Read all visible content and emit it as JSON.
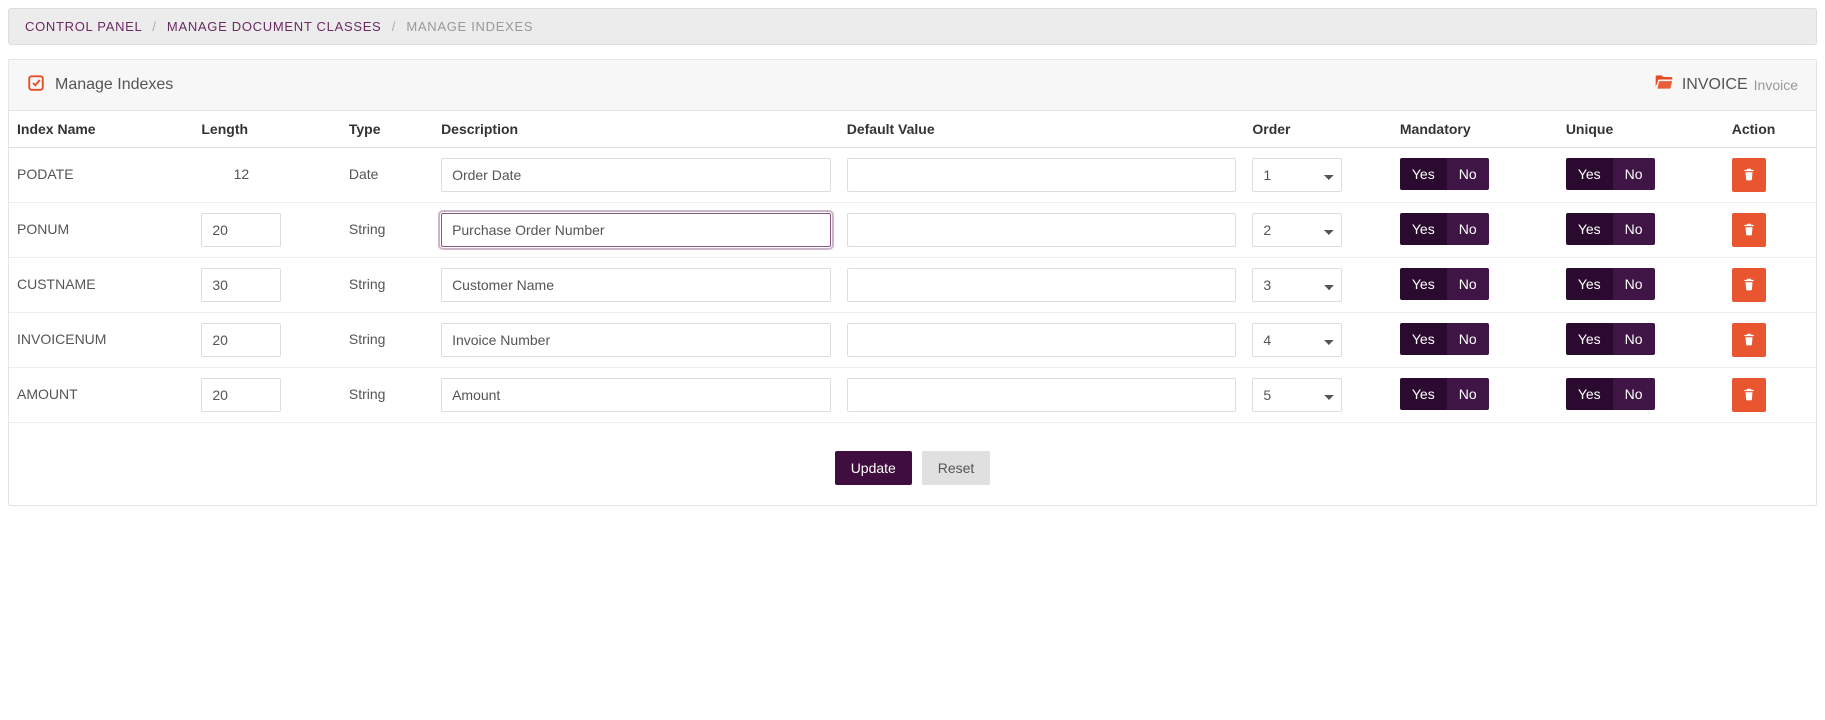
{
  "breadcrumb": {
    "items": [
      "CONTROL PANEL",
      "MANAGE DOCUMENT CLASSES",
      "MANAGE INDEXES"
    ]
  },
  "panel": {
    "title": "Manage Indexes",
    "doc_code": "INVOICE",
    "doc_name": "Invoice"
  },
  "headers": {
    "name": "Index Name",
    "length": "Length",
    "type": "Type",
    "description": "Description",
    "default": "Default Value",
    "order": "Order",
    "mandatory": "Mandatory",
    "unique": "Unique",
    "action": "Action"
  },
  "toggle": {
    "yes": "Yes",
    "no": "No"
  },
  "footer": {
    "update": "Update",
    "reset": "Reset"
  },
  "rows": [
    {
      "name": "PODATE",
      "length": "12",
      "length_editable": false,
      "type": "Date",
      "description": "Order Date",
      "default": "",
      "order": "1",
      "focused": false
    },
    {
      "name": "PONUM",
      "length": "20",
      "length_editable": true,
      "type": "String",
      "description": "Purchase Order Number",
      "default": "",
      "order": "2",
      "focused": true
    },
    {
      "name": "CUSTNAME",
      "length": "30",
      "length_editable": true,
      "type": "String",
      "description": "Customer Name",
      "default": "",
      "order": "3",
      "focused": false
    },
    {
      "name": "INVOICENUM",
      "length": "20",
      "length_editable": true,
      "type": "String",
      "description": "Invoice Number",
      "default": "",
      "order": "4",
      "focused": false
    },
    {
      "name": "AMOUNT",
      "length": "20",
      "length_editable": true,
      "type": "String",
      "description": "Amount",
      "default": "",
      "order": "5",
      "focused": false
    }
  ]
}
